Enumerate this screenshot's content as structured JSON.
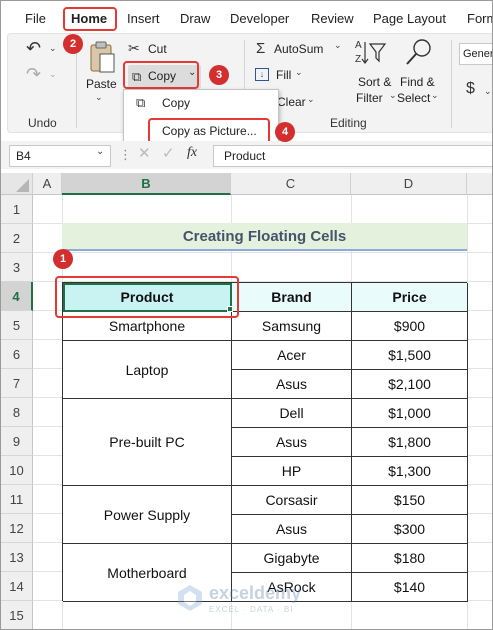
{
  "menu": {
    "tabs": [
      "File",
      "Home",
      "Insert",
      "Draw",
      "Developer",
      "Review",
      "Page Layout",
      "Form"
    ]
  },
  "ribbon": {
    "undo_group_label": "Undo",
    "clipboard": {
      "paste_label": "Paste",
      "cut_label": "Cut",
      "copy_label": "Copy"
    },
    "editing": {
      "autosum_label": "AutoSum",
      "fill_label": "Fill",
      "clear_label": "Clear",
      "sort_filter_label": [
        "Sort &",
        "Filter"
      ],
      "find_select_label": [
        "Find &",
        "Select"
      ],
      "group_label": "Editing"
    },
    "number": {
      "format_label": "Gener",
      "currency_symbol": "$"
    }
  },
  "copy_menu": {
    "items": [
      "Copy",
      "Copy as Picture..."
    ]
  },
  "formula_bar": {
    "name_box": "B4",
    "fx": "fx",
    "content": "Product"
  },
  "sheet": {
    "columns": [
      "A",
      "B",
      "C",
      "D"
    ],
    "rows": [
      "1",
      "2",
      "3",
      "4",
      "5",
      "6",
      "7",
      "8",
      "9",
      "10",
      "11",
      "12",
      "13",
      "14",
      "15"
    ],
    "title": "Creating Floating Cells",
    "table_headers": [
      "Product",
      "Brand",
      "Price"
    ],
    "products": [
      "Smartphone",
      "Laptop",
      "Pre-built PC",
      "Power Supply",
      "Motherboard"
    ],
    "brands": [
      "Samsung",
      "Acer",
      "Asus",
      "Dell",
      "Asus",
      "HP",
      "Corsasir",
      "Asus",
      "Gigabyte",
      "AsRock"
    ],
    "prices": [
      "$900",
      "$1,500",
      "$2,100",
      "$1,000",
      "$1,800",
      "$1,300",
      "$150",
      "$300",
      "$180",
      "$140"
    ]
  },
  "badges": [
    "1",
    "2",
    "3",
    "4"
  ],
  "watermark": {
    "name": "exceldemy",
    "tagline": "EXCEL · DATA · BI"
  },
  "colors": {
    "highlight_red": "#e53935",
    "badge_red": "#d32f2f",
    "title_fill": "#e3f1dd",
    "title_text": "#44546a",
    "header_fill": "#e9fbfb",
    "selection_green": "#1e7145"
  }
}
